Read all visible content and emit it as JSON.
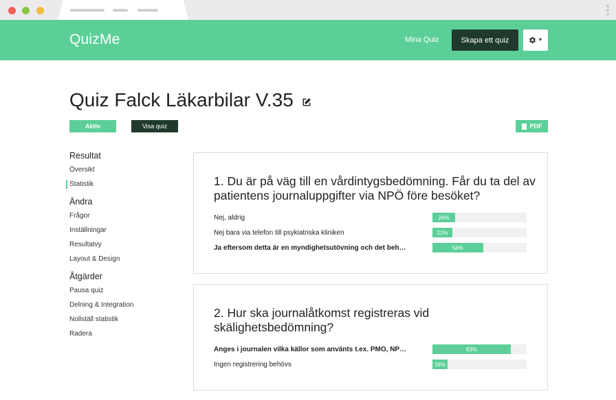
{
  "app": {
    "name": "QuizMe"
  },
  "header": {
    "my_quizzes": "Mina Quiz",
    "create_quiz": "Skapa ett quiz",
    "settings_icon": "gear-icon"
  },
  "page": {
    "title": "Quiz Falck Läkarbilar V.35",
    "edit_icon": "edit-icon",
    "active_label": "Aktiv",
    "show_quiz_label": "Visa quiz",
    "pdf_label": "PDF"
  },
  "sidebar": {
    "sections": [
      {
        "heading": "Resultat",
        "items": [
          "Översikt",
          "Statistik"
        ]
      },
      {
        "heading": "Ändra",
        "items": [
          "Frågor",
          "Inställningar",
          "Resultatvy",
          "Layout & Design"
        ]
      },
      {
        "heading": "Åtgärder",
        "items": [
          "Pausa quiz",
          "Delning & Integration",
          "Nollställ statistik",
          "Radera"
        ]
      }
    ],
    "active_item": "Statistik"
  },
  "questions": [
    {
      "title": "1. Du är på väg till en vårdintygsbedömning. Får du ta del av patientens journaluppgifter via NPÖ före besöket?",
      "answers": [
        {
          "text": "Nej, aldrig",
          "percent": 24,
          "label": "24%",
          "bold": false
        },
        {
          "text": "Nej bara via telefon till psykiatriska kliniken",
          "percent": 21,
          "label": "21%",
          "bold": false
        },
        {
          "text": "Ja eftersom detta är en myndighetsutövning och det beh…",
          "percent": 54,
          "label": "54%",
          "bold": true
        }
      ]
    },
    {
      "title": "2. Hur ska journalåtkomst registreras vid skälighetsbedömning?",
      "answers": [
        {
          "text": "Anges i journalen vilka källor som använts t.ex. PMO, NP…",
          "percent": 83,
          "label": "83%",
          "bold": true
        },
        {
          "text": "Ingen registrering behövs",
          "percent": 16,
          "label": "16%",
          "bold": false
        }
      ]
    }
  ],
  "colors": {
    "accent": "#5ccf99",
    "dark": "#1f3a2c"
  }
}
